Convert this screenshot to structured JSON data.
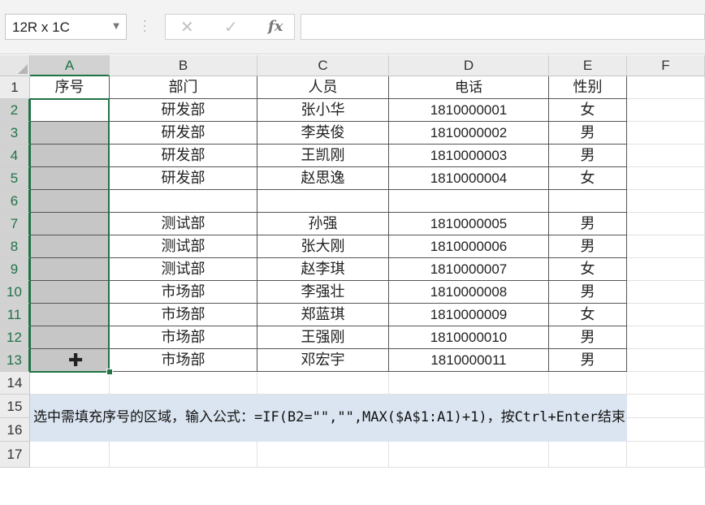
{
  "name_box": {
    "value": "12R x 1C"
  },
  "formula_bar": {
    "cancel_icon": "✕",
    "enter_icon": "✓",
    "fx_label": "fx",
    "content": ""
  },
  "columns": [
    "A",
    "B",
    "C",
    "D",
    "E",
    "F"
  ],
  "rows": [
    "1",
    "2",
    "3",
    "4",
    "5",
    "6",
    "7",
    "8",
    "9",
    "10",
    "11",
    "12",
    "13",
    "14",
    "15",
    "16",
    "17"
  ],
  "header_row": [
    "序号",
    "部门",
    "人员",
    "电话",
    "性别"
  ],
  "table": [
    [
      "",
      "研发部",
      "张小华",
      "1810000001",
      "女"
    ],
    [
      "",
      "研发部",
      "李英俊",
      "1810000002",
      "男"
    ],
    [
      "",
      "研发部",
      "王凯刚",
      "1810000003",
      "男"
    ],
    [
      "",
      "研发部",
      "赵思逸",
      "1810000004",
      "女"
    ],
    [
      "",
      "",
      "",
      "",
      ""
    ],
    [
      "",
      "测试部",
      "孙强",
      "1810000005",
      "男"
    ],
    [
      "",
      "测试部",
      "张大刚",
      "1810000006",
      "男"
    ],
    [
      "",
      "测试部",
      "赵李琪",
      "1810000007",
      "女"
    ],
    [
      "",
      "市场部",
      "李强壮",
      "1810000008",
      "男"
    ],
    [
      "",
      "市场部",
      "郑蓝琪",
      "1810000009",
      "女"
    ],
    [
      "",
      "市场部",
      "王强刚",
      "1810000010",
      "男"
    ],
    [
      "",
      "市场部",
      "邓宏宇",
      "1810000011",
      "男"
    ]
  ],
  "note": "选中需填充序号的区域，输入公式：=IF(B2=\"\",\"\",MAX($A$1:A1)+1)，按Ctrl+Enter结束",
  "colors": {
    "accent": "#217346",
    "note_bg": "#dbe5f1",
    "selection": "#c6c6c6"
  }
}
